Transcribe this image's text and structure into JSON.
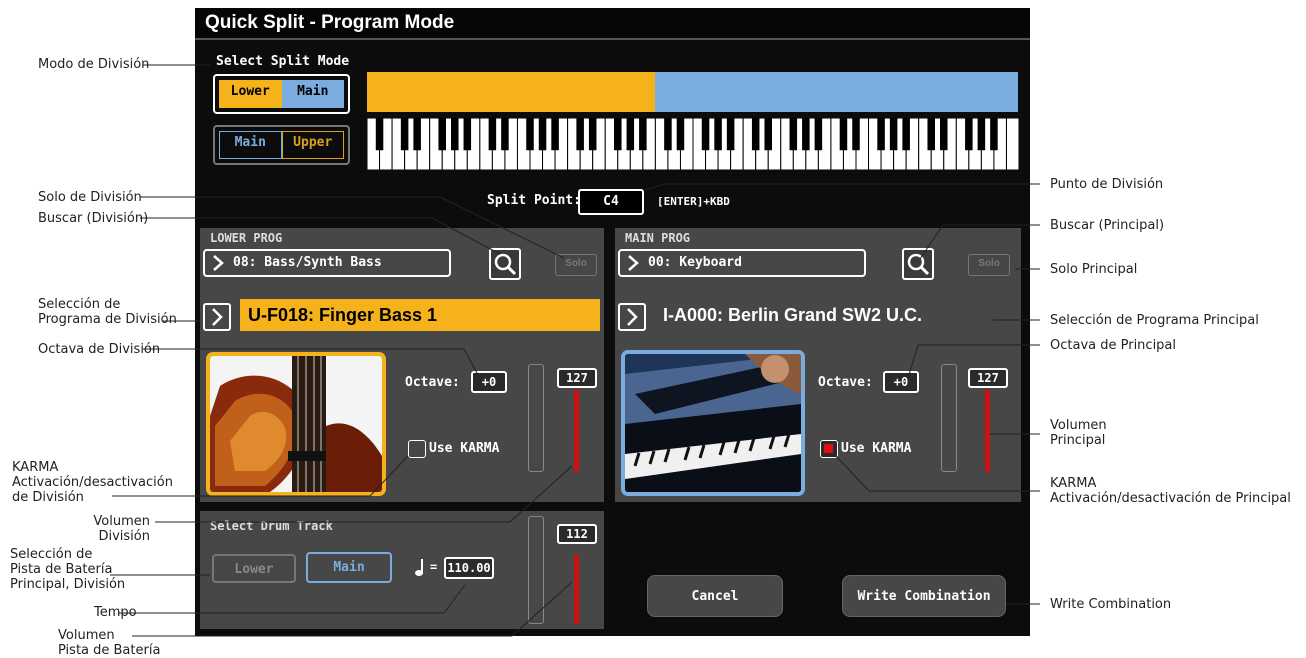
{
  "title": "Quick Split  - Program Mode",
  "split_mode": {
    "label": "Select Split Mode",
    "opt1": {
      "left": "Lower",
      "right": "Main"
    },
    "opt2": {
      "left": "Main",
      "right": "Upper"
    }
  },
  "split_point": {
    "label": "Split Point:",
    "value": "C4",
    "hint": "[ENTER]+KBD"
  },
  "lower": {
    "header": "LOWER PROG",
    "category": "08: Bass/Synth Bass",
    "solo": "Solo",
    "program": "U-F018: Finger Bass 1",
    "octave_label": "Octave:",
    "octave": "+0",
    "karma": "Use KARMA",
    "karma_on": false,
    "volume": "127",
    "volume_level": 1.0
  },
  "main": {
    "header": "MAIN PROG",
    "category": "00: Keyboard",
    "solo": "Solo",
    "program": "I-A000: Berlin Grand SW2 U.C.",
    "octave_label": "Octave:",
    "octave": "+0",
    "karma": "Use KARMA",
    "karma_on": true,
    "volume": "127",
    "volume_level": 1.0
  },
  "drum": {
    "header": "Select Drum Track",
    "lower": "Lower",
    "main": "Main",
    "tempo_eq": "=",
    "tempo": "110.00",
    "volume": "112",
    "volume_level": 0.88
  },
  "buttons": {
    "cancel": "Cancel",
    "write": "Write Combination"
  },
  "annotations": {
    "modo": "Modo de División",
    "solo_div": "Solo de División",
    "buscar_div": "Buscar (División)",
    "sel_prog_div_1": "Selección de",
    "sel_prog_div_2": "Programa de División",
    "oct_div": "Octava de División",
    "karma_div_1": "KARMA",
    "karma_div_2": "Activación/desactivación",
    "karma_div_3": "de División",
    "vol_div_1": "Volumen",
    "vol_div_2": "División",
    "sel_pista_1": "Selección de",
    "sel_pista_2": "Pista de Batería",
    "sel_pista_3": "Principal, División",
    "tempo": "Tempo",
    "vol_pista_1": "Volumen",
    "vol_pista_2": "Pista de Batería",
    "punto": "Punto de División",
    "buscar_pri": "Buscar (Principal)",
    "solo_pri": "Solo Principal",
    "sel_prog_pri": "Selección de Programa Principal",
    "oct_pri": "Octava de Principal",
    "vol_pri_1": "Volumen",
    "vol_pri_2": "Principal",
    "karma_pri_1": "KARMA",
    "karma_pri_2": "Activación/desactivación de Principal",
    "write": "Write Combination"
  },
  "colors": {
    "lower": "#f5b21a",
    "main": "#7aace0",
    "fader": "#d01010",
    "karma_on": "#e01010"
  }
}
